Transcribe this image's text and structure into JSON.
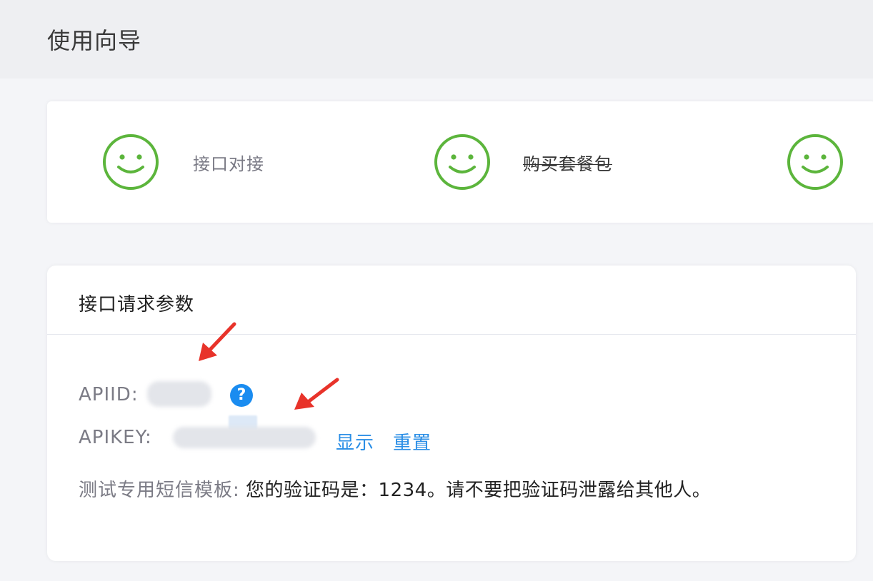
{
  "header": {
    "title": "使用向导"
  },
  "steps": [
    {
      "label": "接口对接"
    },
    {
      "label": "购买套餐包"
    }
  ],
  "params": {
    "title": "接口请求参数",
    "apiid_label": "APIID:",
    "apikey_label": "APIKEY:",
    "show_label": "显示",
    "reset_label": "重置",
    "template_label": "测试专用短信模板:",
    "template_value": "您的验证码是：1234。请不要把验证码泄露给其他人。"
  },
  "colors": {
    "accent_green": "#5cb53c",
    "link_blue": "#2a8ee6",
    "help_blue": "#1a8cf0",
    "arrow_red": "#e8332a"
  },
  "icons": {
    "step": "smiley-icon",
    "help": "question-circle-icon",
    "annotation": "red-arrow-icon"
  }
}
